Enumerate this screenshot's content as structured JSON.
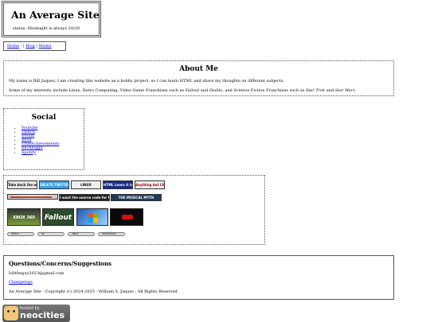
{
  "header": {
    "title": "An Average Site",
    "status": "status: Hindsight is always 20/20"
  },
  "nav": {
    "home": "Home",
    "sep1": " - | ",
    "blog": "Blog",
    "sep2": " | ",
    "media": "Media"
  },
  "about": {
    "heading": "About Me",
    "p1": "My name is Bill Jaques, I am creating this website as a hobby project, so I can learn HTML and share my thoughts on different subjects.",
    "p2_start": "Some of my interests include Linux, Retro Computing, Video Game Franchises such as ",
    "fallout": "Fallout",
    "and1": " and ",
    "diablo": "Diablo",
    "p2_mid": ", and Science Fiction Franchises such as ",
    "startrek": "Star Trek",
    "and2": " and ",
    "starwars": "Star Wars",
    "end": "."
  },
  "social": {
    "heading": "Social",
    "links": [
      "Youtube",
      "Twitch",
      "Steam",
      "Xbox",
      "TrueAchievements",
      "Backloggd",
      "Spotify"
    ]
  },
  "buttons": {
    "badges_row1": [
      "Take back the web",
      "DELETE TWITTER",
      "LINUX",
      "HTML Learn it today!",
      "Anything but Chrome"
    ],
    "badges_row2": [
      "",
      "I want the source code for this",
      "THE MUSICAL MYTH"
    ],
    "big_row": [
      "XBOX 360",
      "Fallout",
      "",
      ""
    ],
    "pills": [
      "AMIGA",
      "PC",
      "XBOX",
      "TELEVISION"
    ]
  },
  "questions": {
    "heading": "Questions/Concerns/Suggestions",
    "email": "billtheguy3023@gmail.com",
    "changelog": "Changelogs",
    "copyright": "An Average Site - Copyright (c) 2024-2025 - William S. Jaques - All Rights Reserved"
  },
  "footer": {
    "hosted": "hosted by",
    "brand": "neocities"
  }
}
